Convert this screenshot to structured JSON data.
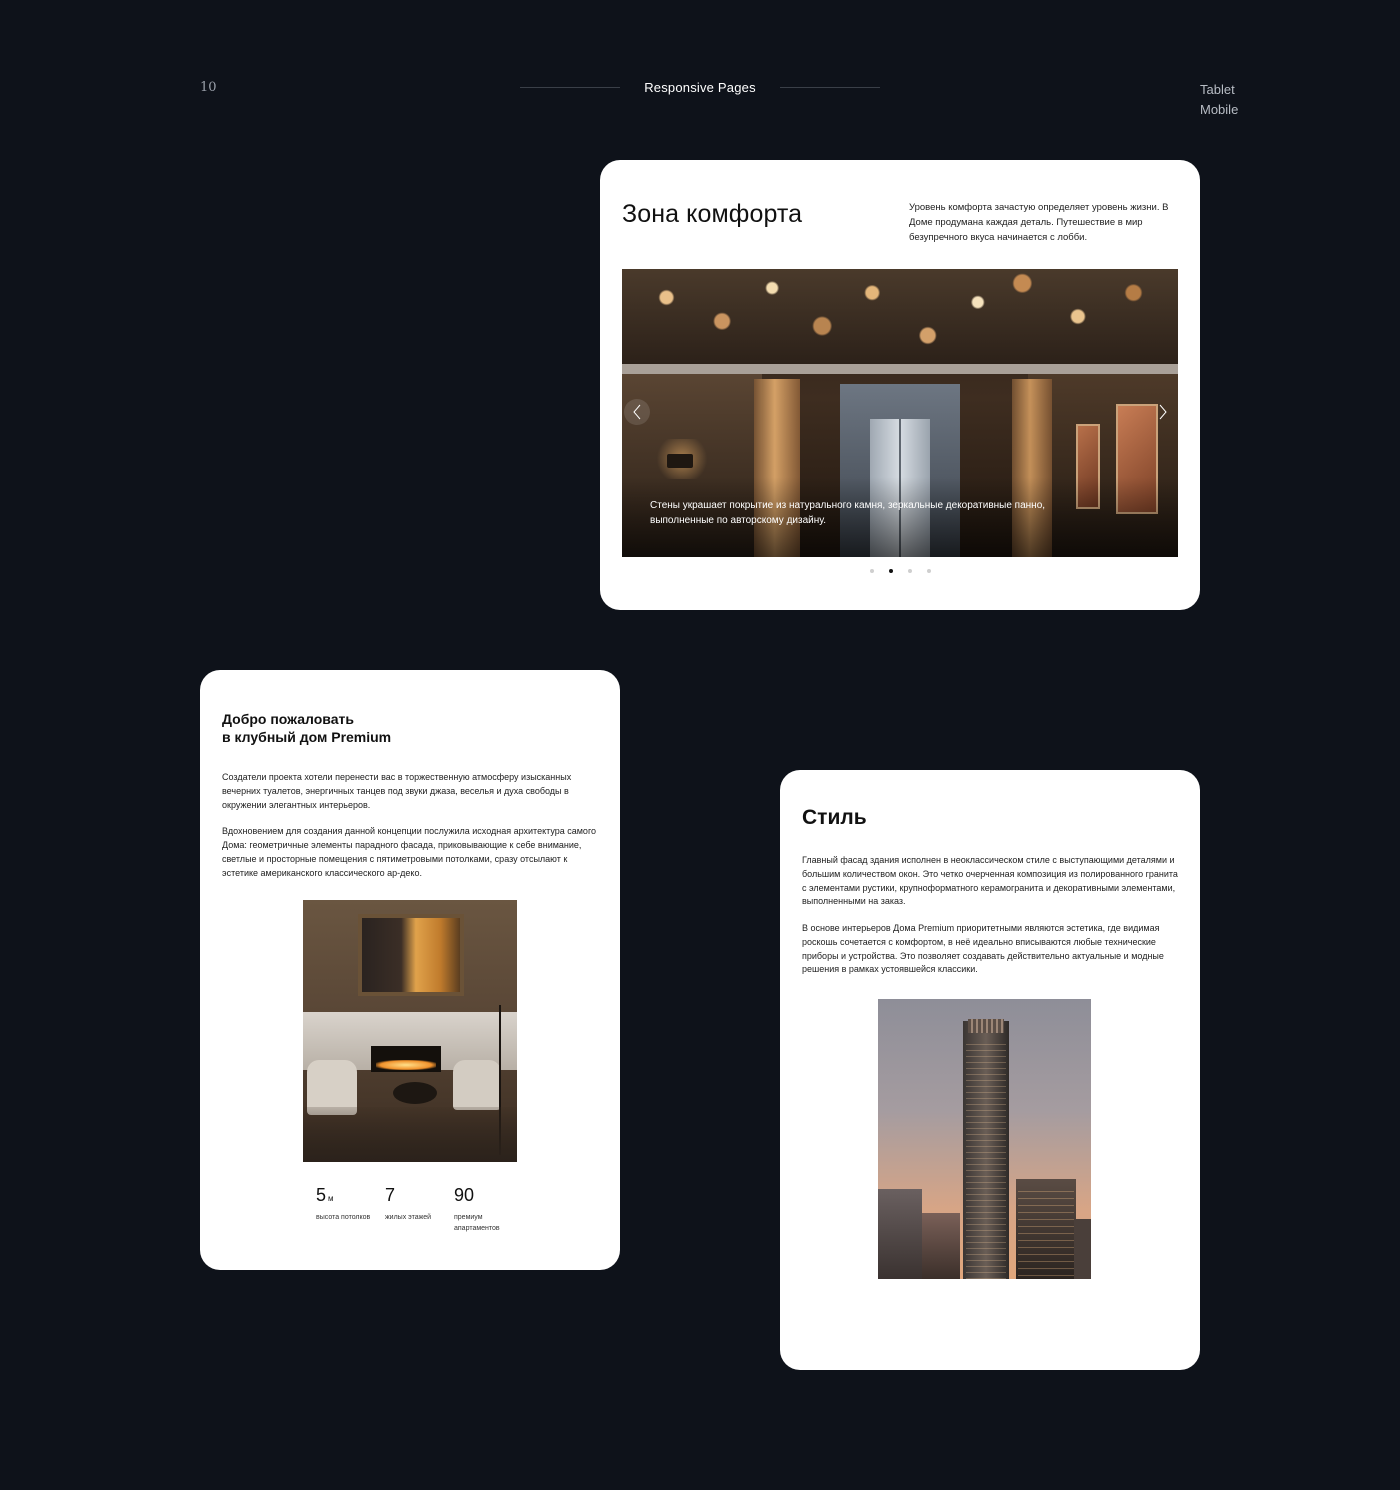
{
  "header": {
    "page_number": "10",
    "title": "Responsive Pages",
    "devices": [
      "Tablet",
      "Mobile"
    ]
  },
  "comfort": {
    "title": "Зона комфорта",
    "description": "Уровень комфорта зачастую определяет уровень жизни. В Доме продумана каждая деталь. Путешествие в мир безупречного вкуса начинается с лобби.",
    "slider": {
      "caption": "Стены украшает покрытие из натурального камня, зеркальные декоративные панно, выполненные по авторскому дизайну.",
      "prev_icon": "chevron-left-icon",
      "next_icon": "chevron-right-icon",
      "dot_count": 4,
      "active_dot": 2
    }
  },
  "welcome": {
    "title_line1": "Добро пожаловать",
    "title_line2": "в клубный дом Premium",
    "p1": "Создатели проекта хотели перенести вас в торжественную атмосферу изысканных вечерних туалетов, энергичных танцев под звуки джаза, веселья и духа свободы в окружении элегантных интерьеров.",
    "p2": "Вдохновением для создания данной концепции послужила исходная архитектура самого Дома: геометричные элементы парадного фасада, приковывающие к себе внимание, светлые и просторные помещения с пятиметровыми потолками, сразу отсылают к эстетике американского классического ар-деко.",
    "stats": [
      {
        "value": "5",
        "unit": "м",
        "label": "высота потолков"
      },
      {
        "value": "7",
        "unit": "",
        "label": "жилых этажей"
      },
      {
        "value": "90",
        "unit": "",
        "label": "премиум апартаментов"
      }
    ]
  },
  "style": {
    "title": "Стиль",
    "p1": "Главный фасад здания исполнен в неоклассическом стиле с выступающими деталями и большим количеством окон. Это четко очерченная композиция из полированного гранита с элементами рустики, крупноформатного керамогранита и декоративными элементами, выполненными на заказ.",
    "p2": "В основе интерьеров Дома Premium приоритетными являются эстетика, где видимая роскошь сочетается с комфортом, в неё идеально вписываются любые технические приборы и устройства. Это позволяет создавать действительно актуальные и модные решения в рамках устоявшейся классики."
  },
  "colors": {
    "background": "#0e121a",
    "card": "#ffffff",
    "text": "#111111"
  }
}
